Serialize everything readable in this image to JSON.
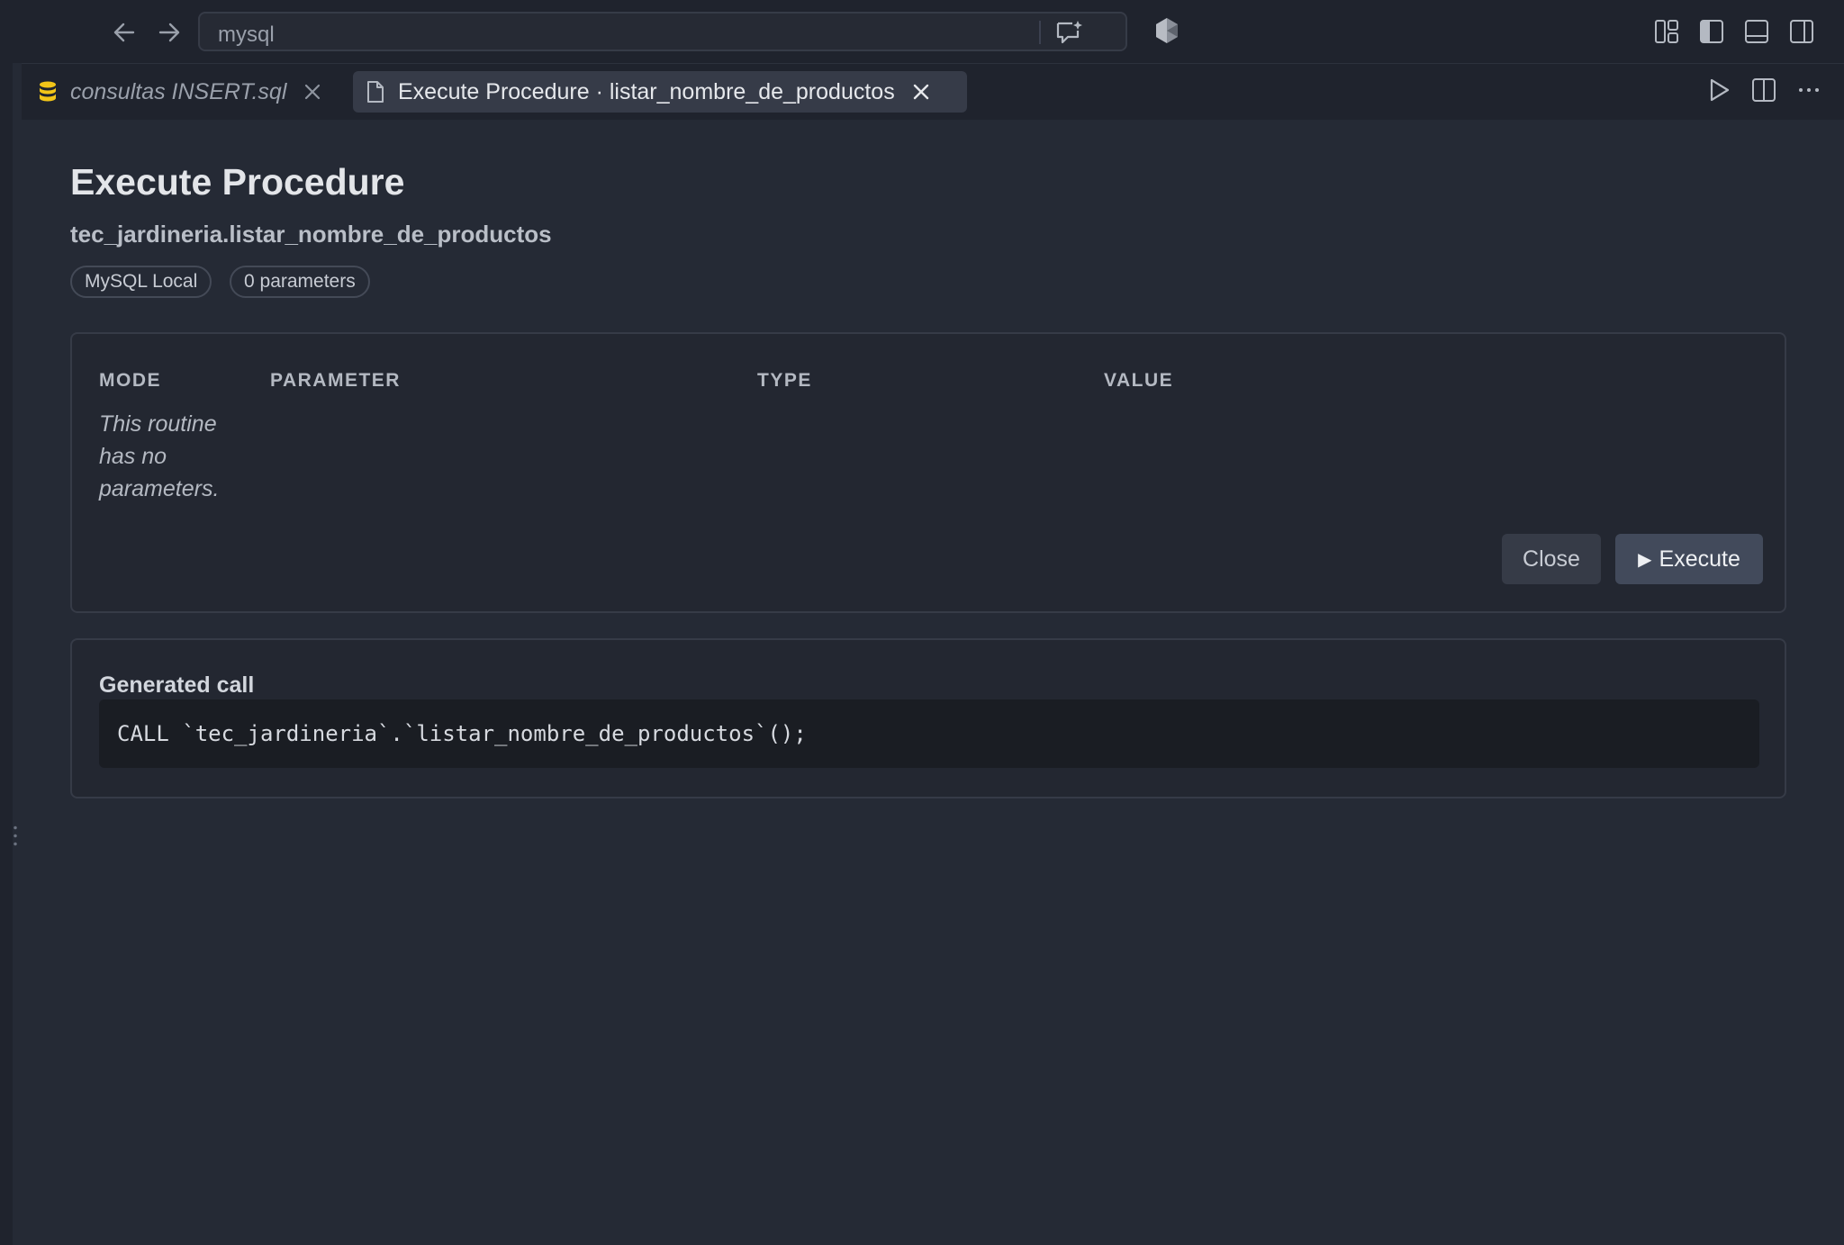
{
  "command_center": {
    "search_text": "mysql"
  },
  "tabs": [
    {
      "label": "consultas INSERT.sql",
      "icon": "database-icon",
      "active": false
    },
    {
      "label": "Execute Procedure · listar_nombre_de_productos",
      "icon": "file-icon",
      "active": true
    }
  ],
  "page": {
    "title": "Execute Procedure",
    "routine": "tec_jardineria.listar_nombre_de_productos",
    "badges": {
      "connection": "MySQL Local",
      "param_count": "0 parameters"
    }
  },
  "params_table": {
    "headers": {
      "mode": "MODE",
      "parameter": "PARAMETER",
      "type": "TYPE",
      "value": "VALUE"
    },
    "empty_message": "This routine has no parameters."
  },
  "buttons": {
    "close": "Close",
    "execute": "Execute"
  },
  "generated_call": {
    "title": "Generated call",
    "sql": "CALL `tec_jardineria`.`listar_nombre_de_productos`();"
  },
  "colors": {
    "background": "#252a35",
    "titlebar": "#1f232d",
    "db_icon": "#f2c518"
  }
}
